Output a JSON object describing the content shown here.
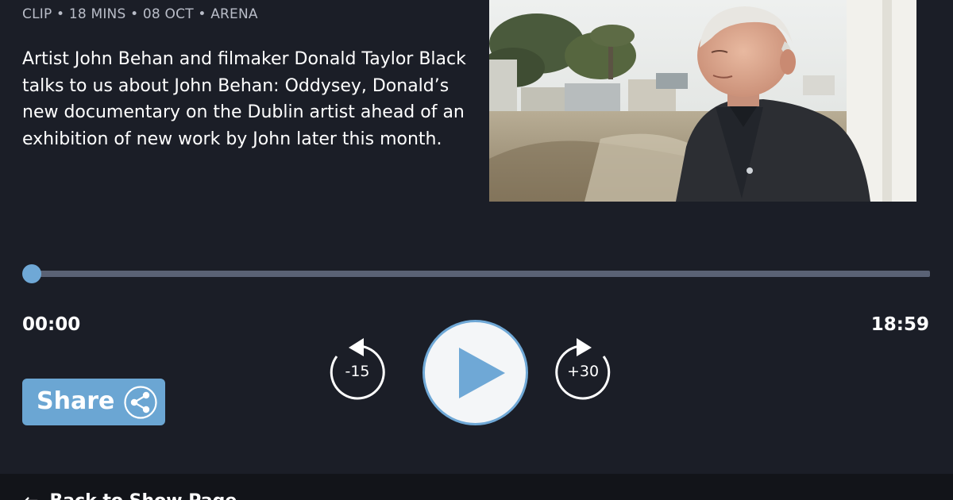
{
  "episode": {
    "meta": "CLIP • 18 MINS • 08 OCT • ARENA",
    "description": "Artist John Behan and filmaker Donald Taylor Black talks to us about John Behan: Oddysey, Donald’s new documentary on the Dublin artist ahead of an exhibition of new work by John later this month."
  },
  "player": {
    "current_time": "00:00",
    "total_time": "18:59",
    "progress_fraction": 0,
    "skip_back_label": "-15",
    "skip_forward_label": "+30",
    "accent_color": "#6fa8d6"
  },
  "share": {
    "label": "Share",
    "icon": "share-icon"
  },
  "footer": {
    "back_label": "Back to Show Page",
    "back_icon": "arrow-left-icon"
  }
}
